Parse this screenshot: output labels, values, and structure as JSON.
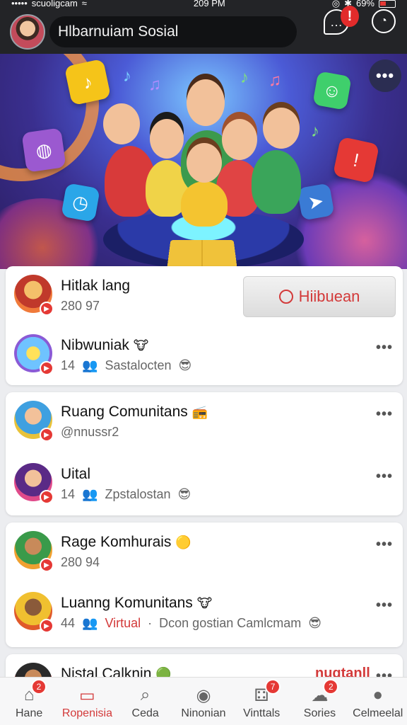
{
  "status_bar": {
    "carrier": "scuoligcam",
    "time": "209 PM",
    "battery": "69%"
  },
  "app_bar": {
    "title": "Hlbarnuiam Sosial",
    "chat_badge": "!"
  },
  "hero": {
    "more_label": "•••"
  },
  "follow_button": {
    "label": "Hiibuean"
  },
  "cards": [
    {
      "rows": [
        {
          "title": "Hitlak lang",
          "sub": "280 97"
        },
        {
          "title": "Nibwuniak",
          "count": "14",
          "sub_text": "Sastalocten"
        }
      ]
    },
    {
      "rows": [
        {
          "title": "Ruang Comunitans",
          "sub": "@nnussr2"
        },
        {
          "title": "Uital",
          "count": "14",
          "sub_text": "Zpstalostan"
        }
      ]
    },
    {
      "rows": [
        {
          "title": "Rage Komhurais",
          "sub": "280 94"
        },
        {
          "title": "Luanng Komunitans",
          "count": "44",
          "virtual": "Virtual",
          "sub_text": "Dcon gostian Camlcmam"
        }
      ]
    },
    {
      "rows": [
        {
          "title": "Nistal Calknin",
          "right_label": "nugtanll"
        }
      ]
    }
  ],
  "bottom_nav": [
    {
      "label": "Hane",
      "icon": "home-icon",
      "badge": "2"
    },
    {
      "label": "Ropenisia",
      "icon": "store-icon",
      "active": true
    },
    {
      "label": "Ceda",
      "icon": "search-icon"
    },
    {
      "label": "Ninonian",
      "icon": "globe-icon"
    },
    {
      "label": "Vinttals",
      "icon": "dice-icon",
      "badge": "7"
    },
    {
      "label": "Sories",
      "icon": "cloud-icon",
      "badge": "2"
    },
    {
      "label": "Celmeelal",
      "icon": "person-icon"
    }
  ],
  "colors": {
    "accent": "#d33a3a",
    "bar": "#232427",
    "badge": "#e53935"
  }
}
